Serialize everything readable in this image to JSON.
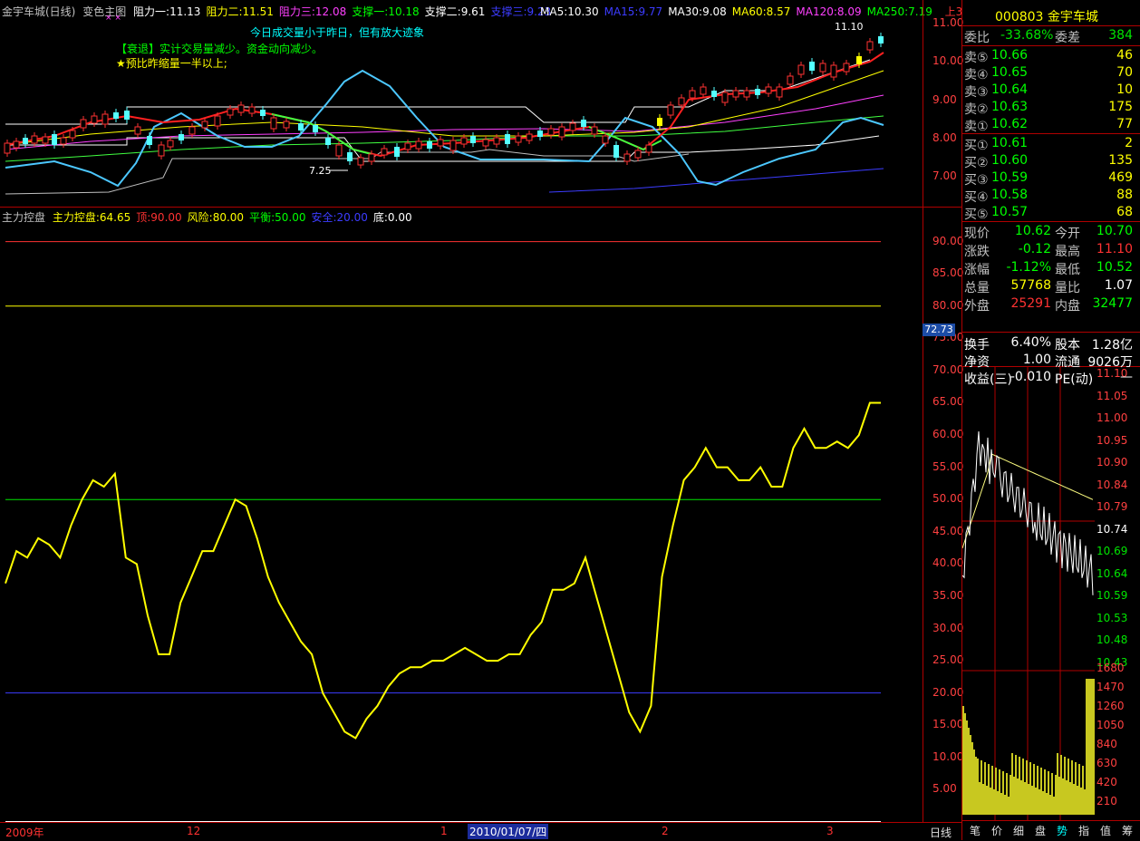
{
  "main_header": {
    "stock": "金宇车城(日线)",
    "indicator": "变色主图",
    "items": [
      {
        "label": "阻力一:11.13",
        "color": "#ffffff"
      },
      {
        "label": "阻力二:11.51",
        "color": "#ffff00"
      },
      {
        "label": "阻力三:12.08",
        "color": "#ff40ff"
      },
      {
        "label": "支撑一:10.18",
        "color": "#00ff00"
      },
      {
        "label": "支撑二:9.61",
        "color": "#ffffff"
      },
      {
        "label": "支撑三:9.23",
        "color": "#3c3cff"
      }
    ],
    "ma": [
      {
        "label": "MA5:10.30",
        "color": "#ffffff"
      },
      {
        "label": "MA15:9.77",
        "color": "#3c3cff"
      },
      {
        "label": "MA30:9.08",
        "color": "#ffffff"
      },
      {
        "label": "MA60:8.57",
        "color": "#ffff00"
      },
      {
        "label": "MA120:8.09",
        "color": "#ff40ff"
      },
      {
        "label": "MA250:7.19",
        "color": "#00ff00"
      }
    ],
    "up_tag": "上3"
  },
  "notes": {
    "line1": "今日成交量小于昨日，但有放大迹象",
    "line2": "【衰退】实计交易量减少。资金动向减少。",
    "line3": "★预比昨缩量一半以上;"
  },
  "main_chart": {
    "high_label": "11.10",
    "low_label": "7.25",
    "price_ticks": [
      "11.00",
      "10.00",
      "9.00",
      "8.00",
      "7.00"
    ]
  },
  "sub_header": {
    "name": "主力控盘",
    "items": [
      {
        "label": "主力控盘:64.65",
        "color": "#ffff00"
      },
      {
        "label": "顶:90.00",
        "color": "#ff3232"
      },
      {
        "label": "风险:80.00",
        "color": "#ffff00"
      },
      {
        "label": "平衡:50.00",
        "color": "#00ff00"
      },
      {
        "label": "安全:20.00",
        "color": "#3c3cff"
      },
      {
        "label": "底:0.00",
        "color": "#ffffff"
      }
    ]
  },
  "sub_chart": {
    "ticks": [
      "90.00",
      "85.00",
      "80.00",
      "75.00",
      "70.00",
      "65.00",
      "60.00",
      "55.00",
      "50.00",
      "45.00",
      "40.00",
      "35.00",
      "30.00",
      "25.00",
      "20.00",
      "15.00",
      "10.00",
      "5.00"
    ],
    "cursor_value": "72.73"
  },
  "chart_data": {
    "type": "line",
    "title": "主力控盘",
    "x_count": 80,
    "series": [
      {
        "name": "主力控盘",
        "values": [
          37,
          42,
          41,
          44,
          43,
          41,
          46,
          50,
          53,
          52,
          54,
          41,
          40,
          32,
          26,
          26,
          34,
          38,
          42,
          42,
          46,
          50,
          49,
          44,
          38,
          34,
          31,
          28,
          26,
          20,
          17,
          14,
          13,
          16,
          18,
          21,
          23,
          24,
          24,
          25,
          25,
          26,
          27,
          26,
          25,
          25,
          26,
          26,
          29,
          31,
          36,
          36,
          37,
          41,
          35,
          29,
          23,
          17,
          14,
          18,
          38,
          46,
          53,
          55,
          58,
          55,
          55,
          53,
          53,
          55,
          52,
          52,
          58,
          61,
          58,
          58,
          59,
          58,
          60,
          65,
          65
        ]
      }
    ],
    "reference_lines": [
      {
        "name": "顶",
        "value": 90
      },
      {
        "name": "风险",
        "value": 80
      },
      {
        "name": "平衡",
        "value": 50
      },
      {
        "name": "安全",
        "value": 20
      },
      {
        "name": "底",
        "value": 0
      }
    ],
    "ylim": [
      0,
      95
    ]
  },
  "x_axis": {
    "labels": [
      "2009年",
      "12",
      "1",
      "2010/01/07/四",
      "2",
      "3"
    ],
    "period": "日线"
  },
  "quote_panel": {
    "code_name": "000803 金宇车城",
    "wei_bi_label": "委比",
    "wei_bi_value": "-33.68%",
    "wei_cha_label": "委差",
    "wei_cha_value": "384",
    "asks": [
      {
        "label": "卖⑤",
        "price": "10.66",
        "vol": "46"
      },
      {
        "label": "卖④",
        "price": "10.65",
        "vol": "70"
      },
      {
        "label": "卖③",
        "price": "10.64",
        "vol": "10"
      },
      {
        "label": "卖②",
        "price": "10.63",
        "vol": "175"
      },
      {
        "label": "卖①",
        "price": "10.62",
        "vol": "77"
      }
    ],
    "bids": [
      {
        "label": "买①",
        "price": "10.61",
        "vol": "2"
      },
      {
        "label": "买②",
        "price": "10.60",
        "vol": "135"
      },
      {
        "label": "买③",
        "price": "10.59",
        "vol": "469"
      },
      {
        "label": "买④",
        "price": "10.58",
        "vol": "88"
      },
      {
        "label": "买⑤",
        "price": "10.57",
        "vol": "68"
      }
    ],
    "stats": [
      {
        "l1": "现价",
        "v1": "10.62",
        "c1": "#00ff00",
        "l2": "今开",
        "v2": "10.70",
        "c2": "#00ff00"
      },
      {
        "l1": "涨跌",
        "v1": "-0.12",
        "c1": "#00ff00",
        "l2": "最高",
        "v2": "11.10",
        "c2": "#ff3232"
      },
      {
        "l1": "涨幅",
        "v1": "-1.12%",
        "c1": "#00ff00",
        "l2": "最低",
        "v2": "10.52",
        "c2": "#00ff00"
      },
      {
        "l1": "总量",
        "v1": "57768",
        "c1": "#ffff00",
        "l2": "量比",
        "v2": "1.07",
        "c2": "#ffffff"
      },
      {
        "l1": "外盘",
        "v1": "25291",
        "c1": "#ff3232",
        "l2": "内盘",
        "v2": "32477",
        "c2": "#00ff00"
      }
    ],
    "stats2": [
      {
        "l1": "换手",
        "v1": "6.40%",
        "l2": "股本",
        "v2": "1.28亿"
      },
      {
        "l1": "净资",
        "v1": "1.00",
        "l2": "流通",
        "v2": "9026万"
      },
      {
        "l1": "收益(三)",
        "v1": "-0.010",
        "l2": "PE(动)",
        "v2": "—"
      }
    ]
  },
  "intraday": {
    "price_ticks": [
      "11.10",
      "11.05",
      "11.00",
      "10.95",
      "10.90",
      "10.84",
      "10.79",
      "10.74",
      "10.69",
      "10.64",
      "10.59",
      "10.53",
      "10.48",
      "10.43"
    ],
    "vol_ticks": [
      "1680",
      "1470",
      "1260",
      "1050",
      "840",
      "630",
      "420",
      "210"
    ]
  },
  "tabs": [
    "笔",
    "价",
    "细",
    "盘",
    "势",
    "指",
    "值",
    "筹"
  ],
  "active_tab": "势",
  "colors": {
    "up": "#ff3232",
    "down": "#54ffff",
    "axis": "#b00000",
    "line": "#ffff00"
  }
}
